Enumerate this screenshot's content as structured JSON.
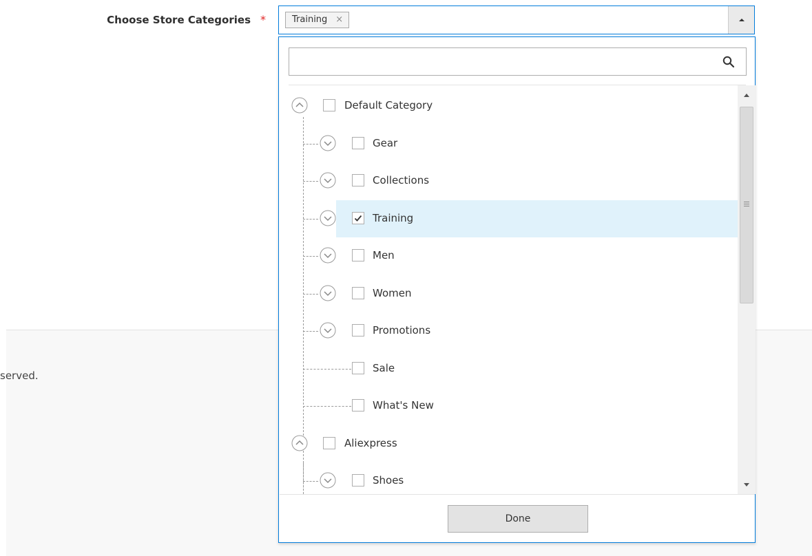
{
  "field": {
    "label": "Choose Store Categories",
    "required_marker": "*",
    "selected_chips": [
      {
        "label": "Training",
        "remove": "×"
      }
    ]
  },
  "dropdown": {
    "search": {
      "value": "",
      "placeholder": ""
    },
    "tree": [
      {
        "label": "Default Category",
        "checked": false,
        "expanded": true,
        "level": 0
      },
      {
        "label": "Gear",
        "checked": false,
        "expanded": false,
        "level": 1
      },
      {
        "label": "Collections",
        "checked": false,
        "expanded": false,
        "level": 1
      },
      {
        "label": "Training",
        "checked": true,
        "expanded": false,
        "level": 1,
        "selected": true
      },
      {
        "label": "Men",
        "checked": false,
        "expanded": false,
        "level": 1
      },
      {
        "label": "Women",
        "checked": false,
        "expanded": false,
        "level": 1
      },
      {
        "label": "Promotions",
        "checked": false,
        "expanded": false,
        "level": 1
      },
      {
        "label": "Sale",
        "checked": false,
        "expanded": null,
        "level": 1
      },
      {
        "label": "What's New",
        "checked": false,
        "expanded": null,
        "level": 1
      },
      {
        "label": "Aliexpress",
        "checked": false,
        "expanded": true,
        "level": 0
      },
      {
        "label": "Shoes",
        "checked": false,
        "expanded": false,
        "level": 1
      }
    ],
    "done_label": "Done"
  },
  "footer": {
    "text": "served."
  },
  "colors": {
    "accent": "#007bdb",
    "required": "#e22626",
    "selected_row": "#e0f2fb"
  }
}
